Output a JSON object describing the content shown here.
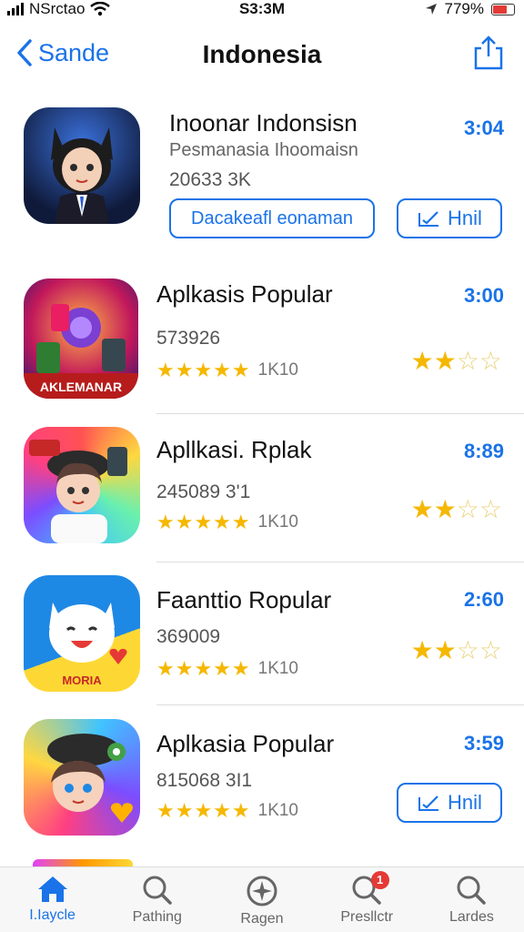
{
  "status": {
    "carrier": "NSrctao",
    "time": "S3:3M",
    "battery": "779%"
  },
  "nav": {
    "back_label": "Sande",
    "title": "Indonesia"
  },
  "apps": [
    {
      "name": "Inoonar Indonsisn",
      "subtitle": "Pesmanasia Ihoomaisn",
      "count": "20633 3K",
      "time": "3:04",
      "action_label": "Dacakeafl eonaman",
      "get_label": "Hnil"
    },
    {
      "name": "Aplkasis Popular",
      "count": "573926",
      "rating_label": "1K10",
      "time": "3:00",
      "stars": 2.5
    },
    {
      "name": "Apllkasi. Rplak",
      "count": "245089 3'1",
      "rating_label": "1K10",
      "time": "8:89",
      "stars": 2.5
    },
    {
      "name": "Faanttio Ropular",
      "count": "369009",
      "rating_label": "1K10",
      "time": "2:60",
      "stars": 2.5
    },
    {
      "name": "Aplkasia Popular",
      "count": "815068 3I1",
      "rating_label": "1K10",
      "time": "3:59",
      "get_label": "Hnil"
    }
  ],
  "tabs": [
    {
      "label": "I.Iaycle",
      "icon": "home-icon",
      "active": true
    },
    {
      "label": "Pathing",
      "icon": "search-icon"
    },
    {
      "label": "Ragen",
      "icon": "compass-icon"
    },
    {
      "label": "Presllctr",
      "icon": "search-icon",
      "badge": "1"
    },
    {
      "label": "Lardes",
      "icon": "search-icon"
    }
  ],
  "colors": {
    "accent": "#1a73e8",
    "star": "#f5b800",
    "badge": "#e53935"
  }
}
